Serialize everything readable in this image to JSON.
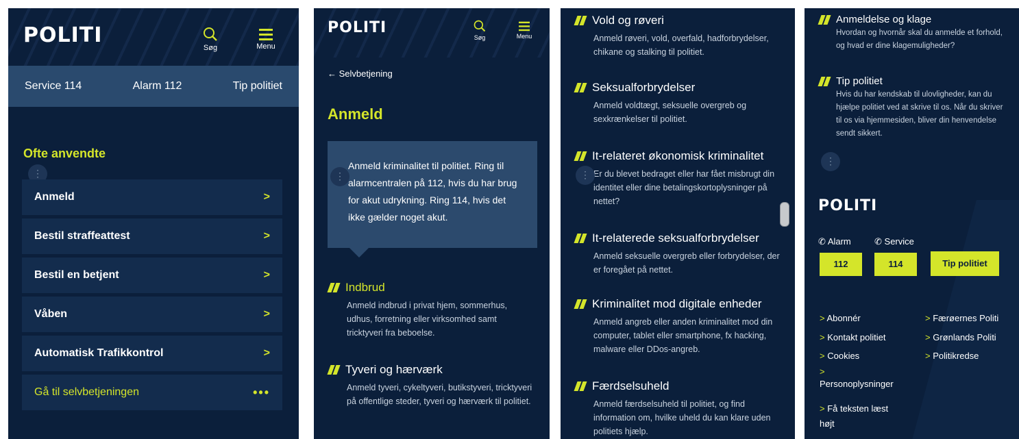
{
  "screen1": {
    "logo": "POLITI",
    "search_label": "Søg",
    "menu_label": "Menu",
    "quick": [
      "Service 114",
      "Alarm 112",
      "Tip politiet"
    ],
    "section_title": "Ofte anvendte",
    "items": [
      "Anmeld",
      "Bestil straffeattest",
      "Bestil en betjent",
      "Våben",
      "Automatisk Trafikkontrol"
    ],
    "chevron": ">",
    "selfservice": "Gå til selvbetjeningen",
    "dots": "•••"
  },
  "screen2": {
    "logo": "POLITI",
    "search_label": "Søg",
    "menu_label": "Menu",
    "back": "Selvbetjening",
    "title": "Anmeld",
    "intro": "Anmeld kriminalitet til politiet. Ring til alarmcentralen på 112, hvis du har brug for akut udrykning. Ring 114, hvis det ikke gælder noget akut.",
    "categories": [
      {
        "title": "Indbrud",
        "desc": "Anmeld indbrud i privat hjem, sommerhus, udhus, forretning eller virksomhed samt tricktyveri fra beboelse."
      },
      {
        "title": "Tyveri og hærværk",
        "desc": "Anmeld tyveri, cykeltyveri, butikstyveri, tricktyveri på offentlige steder, tyveri og hærværk til politiet."
      }
    ]
  },
  "screen3": {
    "categories": [
      {
        "title": "Vold og røveri",
        "desc": "Anmeld røveri, vold, overfald, hadforbrydelser, chikane og stalking til politiet."
      },
      {
        "title": "Seksualforbrydelser",
        "desc": "Anmeld voldtægt, seksuelle overgreb og sexkrænkelser til politiet."
      },
      {
        "title": "It-relateret økonomisk kriminalitet",
        "desc": "Er du blevet bedraget eller har fået misbrugt din identitet eller dine betalingskortoplysninger på nettet?"
      },
      {
        "title": "It-relaterede seksualforbrydelser",
        "desc": "Anmeld seksuelle overgreb eller forbrydelser, der er foregået på nettet."
      },
      {
        "title": "Kriminalitet mod digitale enheder",
        "desc": "Anmeld angreb eller anden kriminalitet mod din computer, tablet eller smartphone, fx hacking, malware eller DDos-angreb."
      },
      {
        "title": "Færdselsuheld",
        "desc": "Anmeld færdselsuheld til politiet, og find information om, hvilke uheld du kan klare uden politiets hjælp."
      }
    ]
  },
  "screen4": {
    "categories": [
      {
        "title": "Anmeldelse og klage",
        "desc": "Hvordan og hvornår skal du anmelde et forhold, og hvad er dine klagemuligheder?"
      },
      {
        "title": "Tip politiet",
        "desc": "Hvis du har kendskab til ulovligheder, kan du hjælpe politiet ved at skrive til os. Når du skriver til os via hjemmesiden, bliver din henvendelse sendt sikkert."
      }
    ],
    "logo": "POLITI",
    "alarm_label": "Alarm",
    "service_label": "Service",
    "alarm_number": "112",
    "service_number": "114",
    "tip_button": "Tip politiet",
    "links_left": [
      "Abonnér",
      "Kontakt politiet",
      "Cookies",
      "Personoplysninger",
      "Få teksten læst højt"
    ],
    "links_right": [
      "Færøernes Politi",
      "Grønlands Politi",
      "Politikredse"
    ],
    "link_arrow": ">"
  },
  "colors": {
    "navy": "#0b1f3b",
    "accent": "#d4e52a",
    "band": "#2a4a6e",
    "card": "#132c4d"
  }
}
